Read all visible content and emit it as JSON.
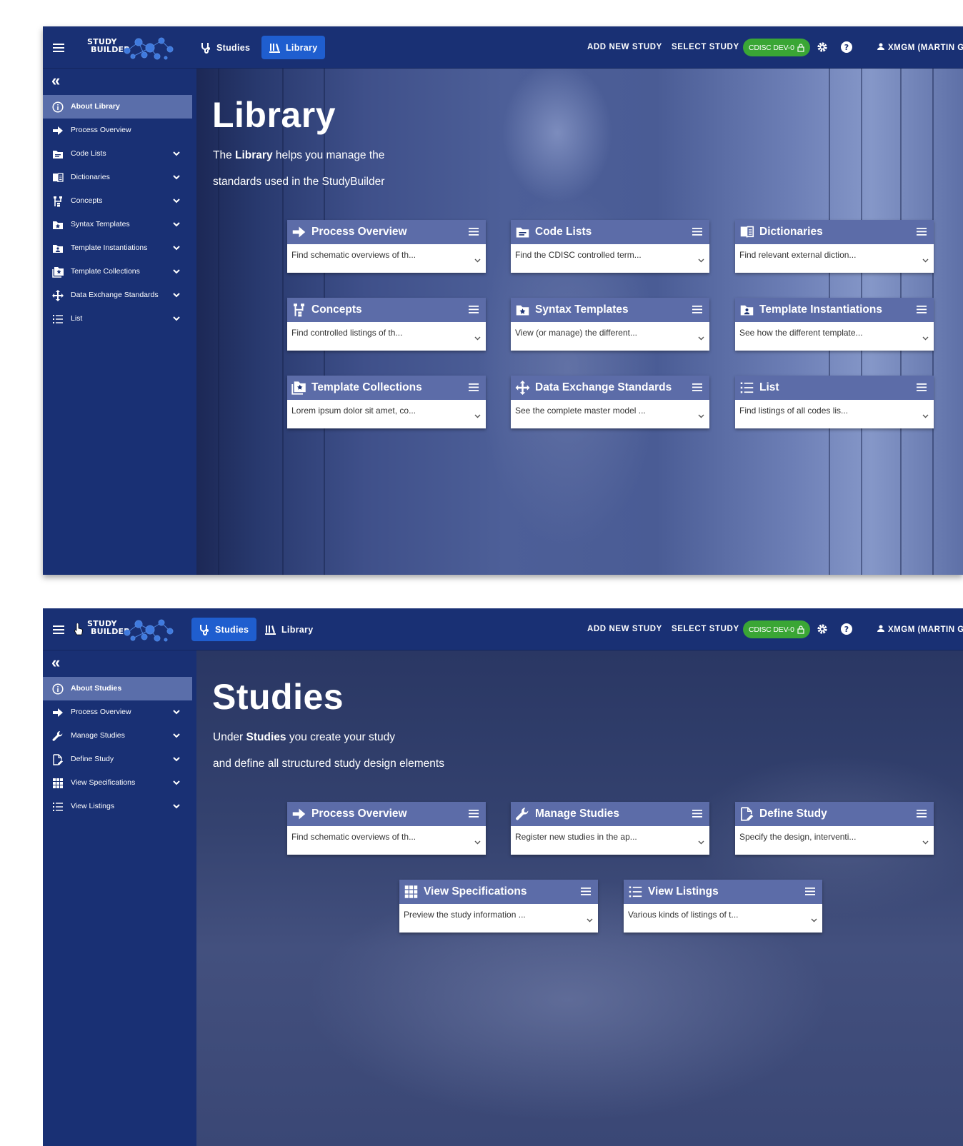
{
  "colors": {
    "navy": "#193074",
    "active_tab": "#1f5ecf",
    "sidebar_active": "#5a6eaa",
    "card_header": "#5c6ca8",
    "env_badge": "#3aa635"
  },
  "logo": {
    "line1": "STUDY",
    "line2": "BUILDER"
  },
  "screens": [
    {
      "topbar": {
        "tabs": [
          {
            "label": "Studies",
            "icon": "stethoscope-icon"
          },
          {
            "label": "Library",
            "icon": "library-icon",
            "active": true
          }
        ],
        "add_new_study": "ADD NEW STUDY",
        "select_study": "SELECT STUDY",
        "environment_badge": "CDISC DEV-0",
        "user": "XMGM (MARTIN G"
      },
      "sidebar": {
        "collapse_icon": "double-chevron-left-icon",
        "items": [
          {
            "label": "About Library",
            "icon": "info-icon",
            "active": true
          },
          {
            "label": "Process Overview",
            "icon": "arrow-right-icon"
          },
          {
            "label": "Code Lists",
            "icon": "folder-icon",
            "expandable": true
          },
          {
            "label": "Dictionaries",
            "icon": "book-icon",
            "expandable": true
          },
          {
            "label": "Concepts",
            "icon": "sitemap-icon",
            "expandable": true
          },
          {
            "label": "Syntax Templates",
            "icon": "folder-star-icon",
            "expandable": true
          },
          {
            "label": "Template Instantiations",
            "icon": "folder-account-icon",
            "expandable": true
          },
          {
            "label": "Template Collections",
            "icon": "folder-multiple-icon",
            "expandable": true
          },
          {
            "label": "Data Exchange Standards",
            "icon": "arrows-all-icon",
            "expandable": true
          },
          {
            "label": "List",
            "icon": "list-icon",
            "expandable": true
          }
        ]
      },
      "hero": {
        "title": "Library",
        "sub1_pre": "The ",
        "sub1_bold": "Library",
        "sub1_post": " helps you manage the",
        "sub2": "standards used in the StudyBuilder"
      },
      "cards": [
        {
          "title": "Process Overview",
          "desc": "Find schematic overviews of th...",
          "icon": "arrow-right-icon"
        },
        {
          "title": "Code Lists",
          "desc": "Find the CDISC controlled term...",
          "icon": "folder-icon"
        },
        {
          "title": "Dictionaries",
          "desc": "Find relevant external diction...",
          "icon": "book-icon"
        },
        {
          "title": "Concepts",
          "desc": "Find controlled listings of th...",
          "icon": "sitemap-icon"
        },
        {
          "title": "Syntax Templates",
          "desc": "View (or manage) the different...",
          "icon": "folder-star-icon"
        },
        {
          "title": "Template Instantiations",
          "desc": "See how the different template...",
          "icon": "folder-account-icon"
        },
        {
          "title": "Template Collections",
          "desc": "Lorem ipsum dolor sit amet, co...",
          "icon": "folder-multiple-icon"
        },
        {
          "title": "Data Exchange Standards",
          "desc": "See the complete master model ...",
          "icon": "arrows-all-icon"
        },
        {
          "title": "List",
          "desc": "Find listings of all codes lis...",
          "icon": "list-icon"
        }
      ]
    },
    {
      "topbar": {
        "tabs": [
          {
            "label": "Studies",
            "icon": "stethoscope-icon",
            "active": true
          },
          {
            "label": "Library",
            "icon": "library-icon"
          }
        ],
        "add_new_study": "ADD NEW STUDY",
        "select_study": "SELECT STUDY",
        "environment_badge": "CDISC DEV-0",
        "user": "XMGM (MARTIN G"
      },
      "sidebar": {
        "collapse_icon": "double-chevron-left-icon",
        "items": [
          {
            "label": "About Studies",
            "icon": "info-icon",
            "active": true
          },
          {
            "label": "Process Overview",
            "icon": "arrow-right-icon",
            "expandable": true
          },
          {
            "label": "Manage Studies",
            "icon": "wrench-icon",
            "expandable": true
          },
          {
            "label": "Define Study",
            "icon": "file-edit-icon",
            "expandable": true
          },
          {
            "label": "View Specifications",
            "icon": "grid-icon",
            "expandable": true
          },
          {
            "label": "View Listings",
            "icon": "list-icon",
            "expandable": true
          }
        ]
      },
      "hero": {
        "title": "Studies",
        "sub1_pre": "Under ",
        "sub1_bold": "Studies",
        "sub1_post": " you create your study",
        "sub2": "and define all structured study design elements"
      },
      "cards": [
        {
          "title": "Process Overview",
          "desc": "Find schematic overviews of th...",
          "icon": "arrow-right-icon"
        },
        {
          "title": "Manage Studies",
          "desc": "Register new studies in the ap...",
          "icon": "wrench-icon"
        },
        {
          "title": "Define Study",
          "desc": "Specify the design, interventi...",
          "icon": "file-edit-icon"
        },
        {
          "title": "View Specifications",
          "desc": "Preview the study information ...",
          "icon": "grid-icon"
        },
        {
          "title": "View Listings",
          "desc": "Various kinds of listings of t...",
          "icon": "list-icon"
        }
      ]
    }
  ]
}
